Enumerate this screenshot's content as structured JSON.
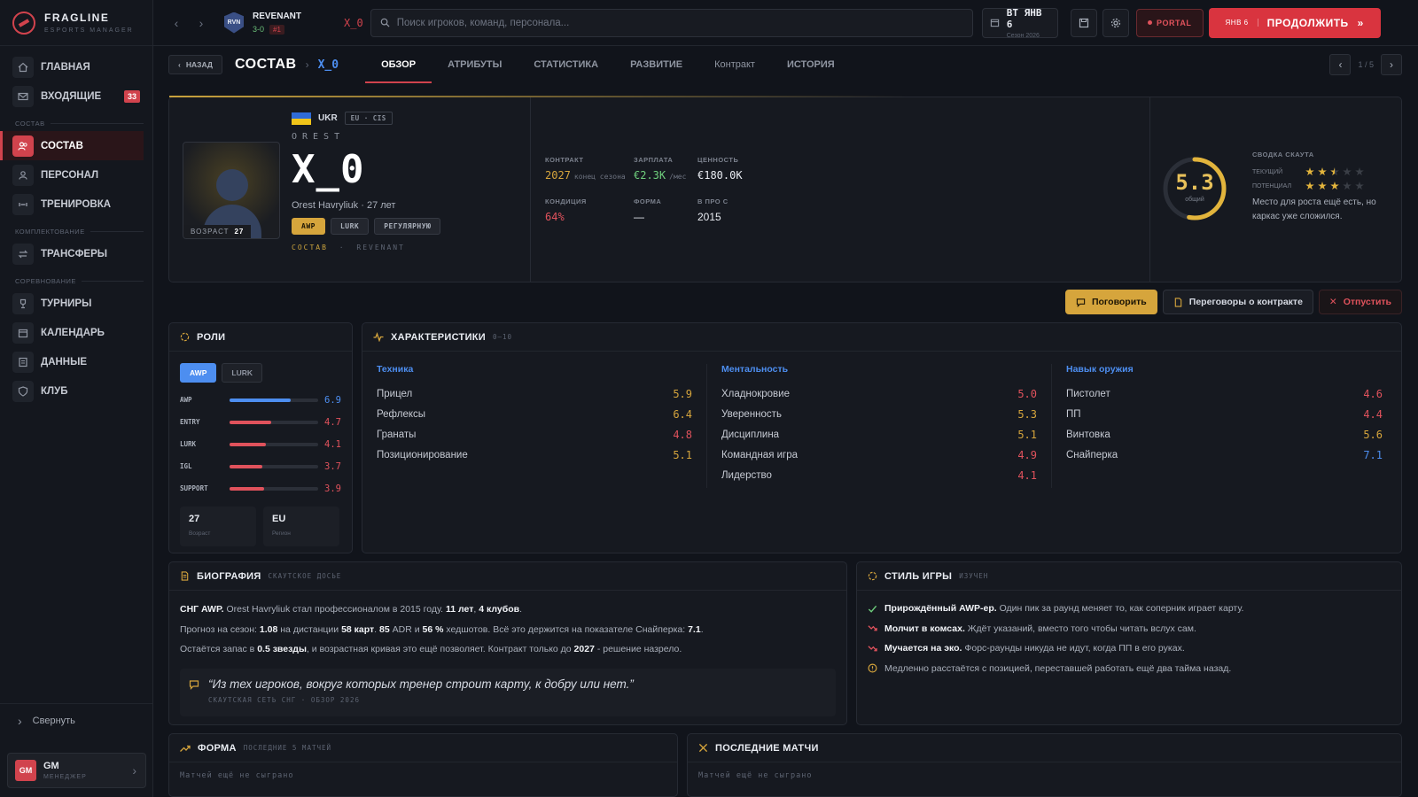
{
  "app": {
    "title": "FRAGLINE",
    "subtitle": "ESPORTS MANAGER"
  },
  "colors": {
    "accent": "#d9343f",
    "gold": "#d6a53c",
    "blue": "#4d8ef0",
    "green": "#6fcf7d",
    "bg": "#11141b"
  },
  "sidebar": {
    "items": [
      {
        "label": "ГЛАВНАЯ",
        "icon": "home-icon"
      },
      {
        "label": "ВХОДЯЩИЕ",
        "icon": "mail-icon",
        "badge": "33"
      }
    ],
    "section_squad": "СОСТАВ",
    "squad_items": [
      {
        "label": "СОСТАВ",
        "icon": "users-icon"
      },
      {
        "label": "ПЕРСОНАЛ",
        "icon": "person-icon"
      },
      {
        "label": "ТРЕНИРОВКА",
        "icon": "dumbbell-icon"
      }
    ],
    "section_recruit": "КОМПЛЕКТОВАНИЕ",
    "recruit_items": [
      {
        "label": "ТРАНСФЕРЫ",
        "icon": "transfer-icon"
      }
    ],
    "section_comp": "СОРЕВНОВАНИЕ",
    "comp_items": [
      {
        "label": "ТУРНИРЫ",
        "icon": "trophy-icon"
      },
      {
        "label": "КАЛЕНДАРЬ",
        "icon": "calendar-icon"
      },
      {
        "label": "ДАННЫЕ",
        "icon": "data-icon"
      },
      {
        "label": "КЛУБ",
        "icon": "shield-icon"
      }
    ],
    "collapse_label": "Свернуть",
    "user": {
      "initials": "GM",
      "name": "GM",
      "role": "МЕНЕДЖЕР"
    }
  },
  "topbar": {
    "team": {
      "logo": "RVN",
      "name": "REVENANT",
      "record": "3-0",
      "rank": "#1"
    },
    "player_tag": "X_0",
    "search_placeholder": "Поиск игроков, команд, персонала...",
    "date": {
      "main": "ВТ ЯНВ 6",
      "sub": "Сезон 2026"
    },
    "portal_label": "PORTAL",
    "continue": {
      "day": "ЯНВ 6",
      "label": "ПРОДОЛЖИТЬ"
    }
  },
  "subheader": {
    "back_label": "НАЗАД",
    "title": "СОСТАВ",
    "player": "X_0",
    "tabs": [
      "ОБЗОР",
      "АТРИБУТЫ",
      "СТАТИСТИКА",
      "РАЗВИТИЕ",
      "Контракт",
      "ИСТОРИЯ"
    ],
    "pager": "1 / 5"
  },
  "player": {
    "age_label": "ВОЗРАСТ",
    "age": "27",
    "country": "UKR",
    "region": "EU · CIS",
    "first_name": "OREST",
    "nickname": "X_0",
    "fullline": "Orest Havryliuk · 27 лет",
    "chips": [
      "AWP",
      "LURK",
      "РЕГУЛЯРНУЮ"
    ],
    "team_label": "СОСТАВ",
    "team_sep": "·",
    "team_name": "REVENANT"
  },
  "facts": {
    "contract": {
      "label": "КОНТРАКТ",
      "value": "2027",
      "unit": "конец сезона"
    },
    "salary": {
      "label": "ЗАРПЛАТА",
      "value": "€2.3K",
      "unit": "/мес"
    },
    "worth": {
      "label": "ЦЕННОСТЬ",
      "value": "€180.0K"
    },
    "condition": {
      "label": "КОНДИЦИЯ",
      "value": "64%"
    },
    "form": {
      "label": "ФОРМА",
      "value": "—"
    },
    "pro_since": {
      "label": "В ПРО С",
      "value": "2015"
    }
  },
  "overall": {
    "value": "5.3",
    "label": "общий",
    "fraction": 0.53
  },
  "scout": {
    "title": "СВОДКА СКАУТА",
    "current_label": "ТЕКУЩИЙ",
    "current_stars": 2.5,
    "potential_label": "ПОТЕНЦИАЛ",
    "potential_stars": 3,
    "note": "Место для роста ещё есть, но каркас уже сложился."
  },
  "actions": {
    "talk": "Поговорить",
    "negotiate": "Переговоры о контракте",
    "release": "Отпустить"
  },
  "roles": {
    "title": "РОЛИ",
    "tabs": [
      "AWP",
      "LURK"
    ],
    "rows": [
      {
        "name": "AWP",
        "value": "6.9",
        "fraction": 0.69,
        "color": "#4d8ef0"
      },
      {
        "name": "ENTRY",
        "value": "4.7",
        "fraction": 0.47,
        "color": "#e0525c"
      },
      {
        "name": "LURK",
        "value": "4.1",
        "fraction": 0.41,
        "color": "#e0525c"
      },
      {
        "name": "IGL",
        "value": "3.7",
        "fraction": 0.37,
        "color": "#e0525c"
      },
      {
        "name": "SUPPORT",
        "value": "3.9",
        "fraction": 0.39,
        "color": "#e0525c"
      }
    ],
    "cards": [
      {
        "value": "27",
        "label": "Возраст"
      },
      {
        "value": "EU",
        "label": "Регион"
      }
    ]
  },
  "attributes": {
    "title": "ХАРАКТЕРИСТИКИ",
    "scale": "0–10",
    "columns": [
      {
        "title": "Техника",
        "rows": [
          {
            "name": "Прицел",
            "value": "5.9",
            "color": "#d6a53c"
          },
          {
            "name": "Рефлексы",
            "value": "6.4",
            "color": "#d6a53c"
          },
          {
            "name": "Гранаты",
            "value": "4.8",
            "color": "#e0525c"
          },
          {
            "name": "Позиционирование",
            "value": "5.1",
            "color": "#d6a53c"
          }
        ]
      },
      {
        "title": "Ментальность",
        "rows": [
          {
            "name": "Хладнокровие",
            "value": "5.0",
            "color": "#e0525c"
          },
          {
            "name": "Уверенность",
            "value": "5.3",
            "color": "#d6a53c"
          },
          {
            "name": "Дисциплина",
            "value": "5.1",
            "color": "#d6a53c"
          },
          {
            "name": "Командная игра",
            "value": "4.9",
            "color": "#e0525c"
          },
          {
            "name": "Лидерство",
            "value": "4.1",
            "color": "#e0525c"
          }
        ]
      },
      {
        "title": "Навык оружия",
        "rows": [
          {
            "name": "Пистолет",
            "value": "4.6",
            "color": "#e0525c"
          },
          {
            "name": "ПП",
            "value": "4.4",
            "color": "#e0525c"
          },
          {
            "name": "Винтовка",
            "value": "5.6",
            "color": "#d6a53c"
          },
          {
            "name": "Снайперка",
            "value": "7.1",
            "color": "#4d8ef0"
          }
        ]
      }
    ]
  },
  "bio": {
    "title": "БИОГРАФИЯ",
    "subtitle": "СКАУТСКОЕ ДОСЬЕ",
    "l1": {
      "a": "СНГ AWP.",
      "b": " Orest Havryliuk стал профессионалом в 2015 году. ",
      "c": "11 лет",
      "d": ", ",
      "e": "4 клубов",
      "f": "."
    },
    "l2": {
      "a": "Прогноз на сезон: ",
      "b": "1.08",
      "c": " на дистанции ",
      "d": "58 карт",
      "e": ". ",
      "f": "85",
      "g": " ADR и ",
      "h": "56 %",
      "i": " хедшотов. Всё это держится на показателе Снайперка: ",
      "j": "7.1",
      "k": "."
    },
    "l3": {
      "a": "Остаётся запас в ",
      "b": "0.5 звезды",
      "c": ", и возрастная кривая это ещё позволяет. Контракт только до ",
      "d": "2027",
      "e": " - решение назрело."
    },
    "quote": "“Из тех игроков, вокруг которых тренер строит карту, к добру или нет.”",
    "quote_src": "СКАУТСКАЯ СЕТЬ СНГ · ОБЗОР 2026"
  },
  "style": {
    "title": "СТИЛЬ ИГРЫ",
    "subtitle": "ИЗУЧЕН",
    "rows": [
      {
        "bold": "Прирождённый AWP-ер.",
        "text": " Один пик за раунд меняет то, как соперник играет карту.",
        "icon": "check-icon",
        "color": "#6fcf7d"
      },
      {
        "bold": "Молчит в комсах.",
        "text": " Ждёт указаний, вместо того чтобы читать вслух сам.",
        "icon": "trend-down-icon",
        "color": "#e0525c"
      },
      {
        "bold": "Мучается на эко.",
        "text": " Форс-раунды никуда не идут, когда ПП в его руках.",
        "icon": "trend-down-icon",
        "color": "#e0525c"
      },
      {
        "bold": "",
        "text": "Медленно расстаётся с позицией, переставшей работать ещё два тайма назад.",
        "icon": "info-icon",
        "color": "#d6a53c"
      }
    ]
  },
  "form_panel": {
    "title": "ФОРМА",
    "subtitle": "ПОСЛЕДНИЕ 5 МАТЧЕЙ",
    "empty": "Матчей ещё не сыграно"
  },
  "matches_panel": {
    "title": "ПОСЛЕДНИЕ МАТЧИ",
    "empty": "Матчей ещё не сыграно"
  }
}
